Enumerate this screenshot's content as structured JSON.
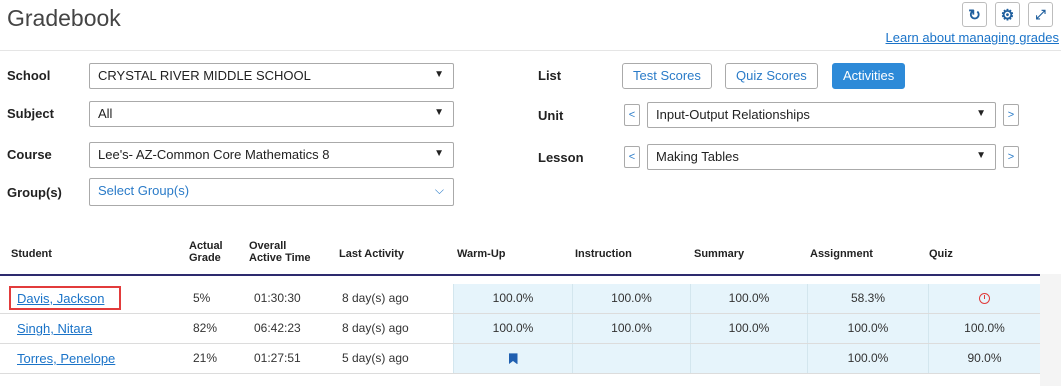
{
  "header": {
    "title": "Gradebook",
    "refresh_icon": "refresh-icon",
    "settings_icon": "gear-icon",
    "expand_icon": "expand-icon",
    "help_link": "Learn about managing grades"
  },
  "filters": {
    "school": {
      "label": "School",
      "value": "CRYSTAL RIVER MIDDLE SCHOOL"
    },
    "subject": {
      "label": "Subject",
      "value": "All"
    },
    "course": {
      "label": "Course",
      "value": "Lee's- AZ-Common Core Mathematics 8"
    },
    "groups": {
      "label": "Group(s)",
      "placeholder": "Select Group(s)"
    },
    "list": {
      "label": "List",
      "options": [
        "Test Scores",
        "Quiz Scores",
        "Activities"
      ],
      "active": "Activities"
    },
    "unit": {
      "label": "Unit",
      "value": "Input-Output Relationships"
    },
    "lesson": {
      "label": "Lesson",
      "value": "Making Tables"
    }
  },
  "table": {
    "columns": {
      "student": "Student",
      "actual_grade_1": "Actual",
      "actual_grade_2": "Grade",
      "active_time_1": "Overall",
      "active_time_2": "Active Time",
      "last_activity": "Last Activity",
      "warmup": "Warm-Up",
      "instruction": "Instruction",
      "summary": "Summary",
      "assignment": "Assignment",
      "quiz": "Quiz"
    },
    "rows": [
      {
        "student": "Davis, Jackson",
        "grade": "5%",
        "time": "01:30:30",
        "last": "8 day(s) ago",
        "warmup": "100.0%",
        "instruction": "100.0%",
        "summary": "100.0%",
        "assignment": "58.3%",
        "quiz": "",
        "quiz_icon": "clock-icon"
      },
      {
        "student": "Singh, Nitara",
        "grade": "82%",
        "time": "06:42:23",
        "last": "8 day(s) ago",
        "warmup": "100.0%",
        "instruction": "100.0%",
        "summary": "100.0%",
        "assignment": "100.0%",
        "quiz": "100.0%"
      },
      {
        "student": "Torres, Penelope",
        "grade": "21%",
        "time": "01:27:51",
        "last": "5 day(s) ago",
        "warmup": "",
        "warmup_icon": "bookmark-icon",
        "instruction": "",
        "summary": "",
        "assignment": "100.0%",
        "quiz": "90.0%"
      }
    ]
  },
  "colors": {
    "accent": "#2d8ad8",
    "header_rule": "#2d2a6e",
    "tint": "#e6f4fb",
    "focus": "#e23b3b"
  }
}
